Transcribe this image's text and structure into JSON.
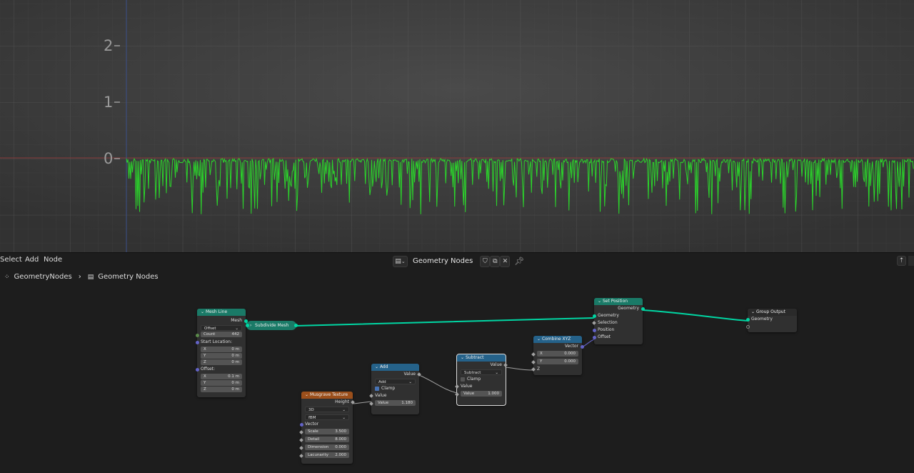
{
  "viewport": {
    "y_axis_labels": [
      "2",
      "1",
      "0"
    ]
  },
  "header": {
    "menu": [
      "Select",
      "Add",
      "Node"
    ],
    "tree_name": "Geometry Nodes"
  },
  "breadcrumb": {
    "object": "GeometryNodes",
    "tree": "Geometry Nodes"
  },
  "colors": {
    "geometry_socket": "#00d6a3",
    "plot_line": "#2bd52b",
    "x_axis": "#8a3a3a",
    "y_axis": "#3a4f8a"
  },
  "nodes": {
    "mesh_line": {
      "title": "Mesh Line",
      "output": "Mesh",
      "mode": "Offset",
      "count_label": "Count",
      "count": "442",
      "start_label": "Start Location:",
      "start": [
        [
          "X",
          "0 m"
        ],
        [
          "Y",
          "0 m"
        ],
        [
          "Z",
          "0 m"
        ]
      ],
      "offset_label": "Offset:",
      "offset": [
        [
          "X",
          "0.1 m"
        ],
        [
          "Y",
          "0 m"
        ],
        [
          "Z",
          "0 m"
        ]
      ]
    },
    "subdivide": {
      "title": "Subdivide Mesh"
    },
    "set_position": {
      "title": "Set Position",
      "output": "Geometry",
      "inputs": [
        "Geometry",
        "Selection",
        "Position",
        "Offset"
      ]
    },
    "group_output": {
      "title": "Group Output",
      "input": "Geometry"
    },
    "combine_xyz": {
      "title": "Combine XYZ",
      "output": "Vector",
      "x_label": "X",
      "x": "0.000",
      "y_label": "Y",
      "y": "0.000",
      "z_label": "Z"
    },
    "subtract": {
      "title": "Subtract",
      "output": "Value",
      "operation": "Subtract",
      "clamp": "Clamp",
      "input": "Value",
      "value_label": "Value",
      "value": "1.000"
    },
    "add": {
      "title": "Add",
      "output": "Value",
      "operation": "Add",
      "clamp": "Clamp",
      "input": "Value",
      "value_label": "Value",
      "value": "1.180"
    },
    "musgrave": {
      "title": "Musgrave Texture",
      "output": "Height",
      "dimensions": "3D",
      "type": "fBM",
      "vector": "Vector",
      "params": [
        [
          "Scale",
          "3.500"
        ],
        [
          "Detail",
          "8.000"
        ],
        [
          "Dimension",
          "0.000"
        ],
        [
          "Lacunarity",
          "2.000"
        ]
      ]
    }
  }
}
